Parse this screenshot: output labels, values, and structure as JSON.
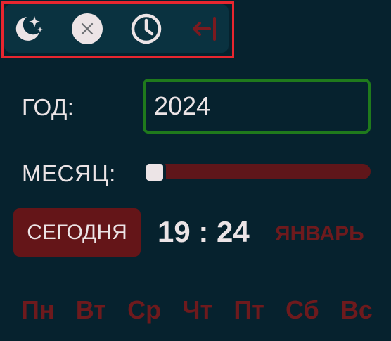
{
  "toolbar": {
    "icons": [
      "moon-stars-icon",
      "close-icon",
      "clock-icon",
      "collapse-left-icon"
    ]
  },
  "year": {
    "label": "ГОД:",
    "value": "2024"
  },
  "month": {
    "label": "МЕСЯЦ:",
    "slider_value": 1,
    "slider_min": 1,
    "slider_max": 12
  },
  "today_button": {
    "label": "СЕГОДНЯ"
  },
  "clock": {
    "time": "19 : 24"
  },
  "month_name": "ЯНВАРЬ",
  "weekdays": [
    "Пн",
    "Вт",
    "Ср",
    "Чт",
    "Пт",
    "Сб",
    "Вс"
  ],
  "colors": {
    "background": "#06222e",
    "toolbar_bg": "#0a3240",
    "accent_red": "#641518",
    "text_red": "#6e1a1d",
    "field_border": "#1f7a1c",
    "highlight_frame": "#e8262f",
    "text_light": "#ece4e6"
  }
}
